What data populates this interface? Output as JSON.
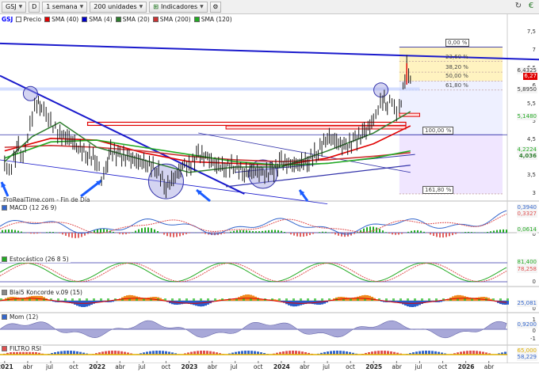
{
  "toolbar": {
    "symbol": "GSJ",
    "d_button": "D",
    "period": "1 semana",
    "units": "200 unidades",
    "indicators": "Indicadores"
  },
  "legend": [
    {
      "label": "GSJ",
      "color": "#0000ff",
      "is_symbol": true
    },
    {
      "label": "Precio",
      "color": "#ffffff"
    },
    {
      "label": "SMA (40)",
      "color": "#e00000"
    },
    {
      "label": "SMA (4)",
      "color": "#0000cc"
    },
    {
      "label": "SMA (20)",
      "color": "#2e7d2e"
    },
    {
      "label": "SMA (200)",
      "color": "#cc3333"
    },
    {
      "label": "SMA (120)",
      "color": "#22aa22"
    }
  ],
  "watermark": "ProRealTime.com - Fin de Día",
  "panes": {
    "macd": {
      "title": "MACD (12 26 9)",
      "ticks": [
        "0"
      ],
      "labels": [
        {
          "text": "0,3940",
          "color": "#3366cc"
        },
        {
          "text": "0,3327",
          "color": "#e05050"
        },
        {
          "text": "0,0614",
          "color": "#22aa22"
        }
      ]
    },
    "stoch": {
      "title": "Estocástico (26 8 5)",
      "ticks": [
        "0"
      ],
      "labels": [
        {
          "text": "81,400",
          "color": "#22aa22"
        },
        {
          "text": "78,258",
          "color": "#e05050"
        }
      ]
    },
    "koncorde": {
      "title": "Blai5 Koncorde v.09 (15)",
      "ticks": [
        "0"
      ],
      "labels": [
        {
          "text": "25,081",
          "color": "#3366cc"
        }
      ]
    },
    "mom": {
      "title": "Mom (12)",
      "ticks": [
        "1",
        "0",
        "-1"
      ],
      "labels": [
        {
          "text": "0,9200",
          "color": "#3366cc"
        }
      ]
    },
    "rsi": {
      "title": "FILTRO RSI",
      "ticks": [],
      "labels": [
        {
          "text": "65,000",
          "color": "#e0b000"
        },
        {
          "text": "58,229",
          "color": "#3366cc"
        }
      ]
    }
  },
  "chart_data": {
    "type": "line",
    "title": "",
    "price_axis": {
      "ticks": [
        "7,5",
        "7",
        "6,5",
        "6",
        "5,5",
        "5",
        "4,5",
        "4",
        "3,5",
        "3"
      ],
      "last_price": "6,27",
      "labels": [
        {
          "text": "6,4325",
          "color": "#f5f5f5",
          "fg": "#333"
        },
        {
          "text": "6,27",
          "color": "#e00000",
          "fg": "#fff"
        },
        {
          "text": "5,8950",
          "color": "#f5f5f5",
          "fg": "#333"
        },
        {
          "text": "5,1480",
          "color": "#f5f5f5",
          "fg": "#22aa22"
        },
        {
          "text": "4,2224",
          "color": "#f5f5f5",
          "fg": "#22aa22"
        },
        {
          "text": "4,036",
          "color": "#f5f5f5",
          "fg": "#2e7d2e"
        }
      ]
    },
    "fib_levels": [
      {
        "label": "0,00 %",
        "value": 7.1
      },
      {
        "label": "23,60 %",
        "value": 6.7
      },
      {
        "label": "38,20 %",
        "value": 6.4
      },
      {
        "label": "50,00 %",
        "value": 6.15
      },
      {
        "label": "61,80 %",
        "value": 5.9
      },
      {
        "label": "100,00 %",
        "value": 4.65
      },
      {
        "label": "161,80 %",
        "value": 3.0
      }
    ],
    "x_axis": [
      "2021",
      "abr",
      "jul",
      "oct",
      "2022",
      "abr",
      "jul",
      "oct",
      "2023",
      "abr",
      "jul",
      "oct",
      "2024",
      "abr",
      "jul",
      "oct",
      "2025",
      "abr",
      "jul",
      "oct",
      "2026",
      "abr"
    ],
    "x_axis_years": [
      "2021",
      "2022",
      "2023",
      "2024",
      "2025",
      "2026"
    ],
    "price": [
      [
        2021.0,
        3.85
      ],
      [
        2021.05,
        3.6
      ],
      [
        2021.1,
        3.95
      ],
      [
        2021.15,
        4.3
      ],
      [
        2021.2,
        4.0
      ],
      [
        2021.25,
        4.6
      ],
      [
        2021.3,
        5.2
      ],
      [
        2021.35,
        5.55
      ],
      [
        2021.4,
        5.45
      ],
      [
        2021.45,
        5.2
      ],
      [
        2021.5,
        5.0
      ],
      [
        2021.55,
        4.8
      ],
      [
        2021.6,
        4.65
      ],
      [
        2021.7,
        4.55
      ],
      [
        2021.8,
        4.3
      ],
      [
        2021.9,
        4.1
      ],
      [
        2022.0,
        3.95
      ],
      [
        2022.05,
        3.4
      ],
      [
        2022.1,
        3.7
      ],
      [
        2022.15,
        4.2
      ],
      [
        2022.25,
        4.05
      ],
      [
        2022.35,
        4.0
      ],
      [
        2022.45,
        3.9
      ],
      [
        2022.55,
        3.85
      ],
      [
        2022.65,
        3.7
      ],
      [
        2022.75,
        3.2
      ],
      [
        2022.85,
        3.5
      ],
      [
        2022.95,
        3.8
      ],
      [
        2023.0,
        3.75
      ],
      [
        2023.1,
        4.1
      ],
      [
        2023.2,
        4.0
      ],
      [
        2023.3,
        3.8
      ],
      [
        2023.4,
        3.75
      ],
      [
        2023.5,
        3.8
      ],
      [
        2023.6,
        3.6
      ],
      [
        2023.7,
        3.65
      ],
      [
        2023.8,
        3.55
      ],
      [
        2023.9,
        3.6
      ],
      [
        2024.0,
        3.9
      ],
      [
        2024.1,
        3.8
      ],
      [
        2024.2,
        3.85
      ],
      [
        2024.3,
        3.95
      ],
      [
        2024.4,
        4.2
      ],
      [
        2024.5,
        4.6
      ],
      [
        2024.6,
        4.45
      ],
      [
        2024.7,
        4.3
      ],
      [
        2024.8,
        4.5
      ],
      [
        2024.9,
        4.7
      ],
      [
        2025.0,
        5.05
      ],
      [
        2025.05,
        5.4
      ],
      [
        2025.1,
        5.65
      ],
      [
        2025.15,
        5.5
      ],
      [
        2025.2,
        5.6
      ],
      [
        2025.25,
        5.2
      ],
      [
        2025.28,
        5.35
      ],
      [
        2025.32,
        5.9
      ],
      [
        2025.36,
        6.6
      ],
      [
        2025.38,
        6.3
      ],
      [
        2025.4,
        6.27
      ]
    ],
    "series": [
      {
        "name": "SMA (40)",
        "color": "#e00000",
        "values": [
          [
            2021.0,
            4.2
          ],
          [
            2021.5,
            4.55
          ],
          [
            2022.0,
            4.5
          ],
          [
            2022.5,
            4.15
          ],
          [
            2023.0,
            3.9
          ],
          [
            2023.5,
            3.85
          ],
          [
            2024.0,
            3.8
          ],
          [
            2024.5,
            4.0
          ],
          [
            2025.0,
            4.4
          ],
          [
            2025.4,
            4.9
          ]
        ]
      },
      {
        "name": "SMA (200)",
        "color": "#cc3333",
        "values": [
          [
            2021.0,
            4.3
          ],
          [
            2021.5,
            4.35
          ],
          [
            2022.0,
            4.3
          ],
          [
            2022.5,
            4.2
          ],
          [
            2023.0,
            4.05
          ],
          [
            2023.5,
            3.95
          ],
          [
            2024.0,
            3.9
          ],
          [
            2024.5,
            3.95
          ],
          [
            2025.0,
            4.05
          ],
          [
            2025.4,
            4.15
          ]
        ]
      },
      {
        "name": "SMA (120)",
        "color": "#22aa22",
        "values": [
          [
            2021.0,
            4.0
          ],
          [
            2021.5,
            4.45
          ],
          [
            2022.0,
            4.5
          ],
          [
            2022.5,
            4.3
          ],
          [
            2023.0,
            4.1
          ],
          [
            2023.5,
            3.9
          ],
          [
            2024.0,
            3.8
          ],
          [
            2024.5,
            3.85
          ],
          [
            2025.0,
            4.0
          ],
          [
            2025.4,
            4.2
          ]
        ]
      },
      {
        "name": "SMA (20)",
        "color": "#2e7d2e",
        "values": [
          [
            2021.0,
            3.9
          ],
          [
            2021.3,
            4.6
          ],
          [
            2021.6,
            5.0
          ],
          [
            2022.0,
            4.3
          ],
          [
            2022.5,
            3.95
          ],
          [
            2023.0,
            3.6
          ],
          [
            2023.5,
            3.75
          ],
          [
            2024.0,
            3.75
          ],
          [
            2024.5,
            4.2
          ],
          [
            2025.0,
            4.7
          ],
          [
            2025.4,
            5.3
          ]
        ]
      }
    ]
  },
  "colors": {
    "trend_line": "#1a1acc",
    "support_line": "#1a1acc",
    "fib_top": "#fff3c0",
    "fib_mid": "#f0e6ff",
    "fib_low": "#e8e0ff",
    "resistance_box": "#e00000",
    "circle_fill": "#a0a0e0"
  },
  "icons": [
    "chevron-down-icon",
    "indicator-icon",
    "settings-icon",
    "refresh-icon",
    "currency-icon"
  ]
}
